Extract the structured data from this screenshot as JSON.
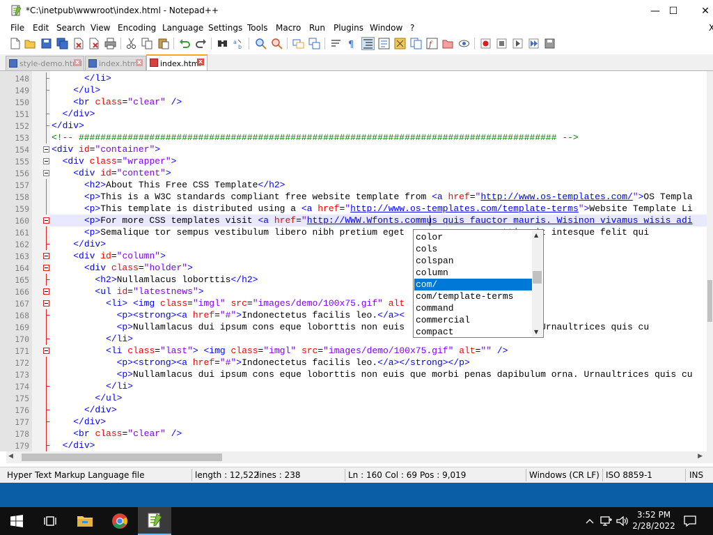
{
  "window": {
    "title": "*C:\\inetpub\\wwwroot\\index.html - Notepad++",
    "minimize": "—",
    "maximize": "☐",
    "close": "✕"
  },
  "menu": [
    "File",
    "Edit",
    "Search",
    "View",
    "Encoding",
    "Language",
    "Settings",
    "Tools",
    "Macro",
    "Run",
    "Plugins",
    "Window",
    "?"
  ],
  "menu_close": "X",
  "tabs": [
    {
      "label": "style-demo.html",
      "active": false
    },
    {
      "label": "index.html",
      "active": false
    },
    {
      "label": "index.html",
      "active": true
    }
  ],
  "tab_close": "x",
  "autocomplete": {
    "items": [
      "color",
      "cols",
      "colspan",
      "column",
      "com/",
      "com/template-terms",
      "command",
      "commercial",
      "compact"
    ],
    "selected": "com/"
  },
  "status": {
    "file_type": "Hyper Text Markup Language file",
    "length": "length : 12,522",
    "lines": "lines : 238",
    "ln": "Ln : 160",
    "col": "Col : 69",
    "pos": "Pos : 9,019",
    "eol": "Windows (CR LF)",
    "encoding": "ISO 8859-1",
    "mode": "INS"
  },
  "taskbar": {
    "time": "3:52 PM",
    "date": "2/28/2022"
  },
  "colors": {
    "tag": "#0000ff",
    "attr": "#ff0000",
    "value": "#8000ff",
    "comment": "#008000",
    "current_line": "#e8e8ff",
    "selection": "#0078d7",
    "desktop": "#0a5ea6"
  },
  "editor": {
    "current_line": "160",
    "lines": [
      {
        "n": "148",
        "ind": "      ",
        "tokens": [
          [
            "t",
            "</li>"
          ]
        ]
      },
      {
        "n": "149",
        "ind": "    ",
        "tokens": [
          [
            "t",
            "</ul>"
          ]
        ]
      },
      {
        "n": "150",
        "ind": "    ",
        "tokens": [
          [
            "t",
            "<br "
          ],
          [
            "a",
            "class"
          ],
          [
            "x",
            "="
          ],
          [
            "v",
            "\"clear\""
          ],
          [
            "t",
            " />"
          ]
        ]
      },
      {
        "n": "151",
        "ind": "  ",
        "tokens": [
          [
            "t",
            "</div>"
          ]
        ]
      },
      {
        "n": "152",
        "ind": "",
        "tokens": [
          [
            "t",
            "</div>"
          ]
        ]
      },
      {
        "n": "153",
        "ind": "",
        "tokens": [
          [
            "c",
            "<!-- ######################################################################################## -->"
          ]
        ]
      },
      {
        "n": "154",
        "ind": "",
        "tokens": [
          [
            "t",
            "<div "
          ],
          [
            "a",
            "id"
          ],
          [
            "x",
            "="
          ],
          [
            "v",
            "\"container\""
          ],
          [
            "t",
            ">"
          ]
        ]
      },
      {
        "n": "155",
        "ind": "  ",
        "tokens": [
          [
            "t",
            "<div "
          ],
          [
            "a",
            "class"
          ],
          [
            "x",
            "="
          ],
          [
            "v",
            "\"wrapper\""
          ],
          [
            "t",
            ">"
          ]
        ]
      },
      {
        "n": "156",
        "ind": "    ",
        "tokens": [
          [
            "t",
            "<div "
          ],
          [
            "a",
            "id"
          ],
          [
            "x",
            "="
          ],
          [
            "v",
            "\"content\""
          ],
          [
            "t",
            ">"
          ]
        ]
      },
      {
        "n": "157",
        "ind": "      ",
        "tokens": [
          [
            "t",
            "<h2>"
          ],
          [
            "x",
            "About This Free CSS Template"
          ],
          [
            "t",
            "</h2>"
          ]
        ]
      },
      {
        "n": "158",
        "ind": "      ",
        "tokens": [
          [
            "t",
            "<p>"
          ],
          [
            "x",
            "This is a W3C standards compliant free website template from "
          ],
          [
            "t",
            "<a "
          ],
          [
            "a",
            "href"
          ],
          [
            "x",
            "="
          ],
          [
            "v",
            "\""
          ],
          [
            "u",
            "http://www.os-templates.com/"
          ],
          [
            "v",
            "\""
          ],
          [
            "t",
            ">"
          ],
          [
            "x",
            "OS Templa"
          ]
        ]
      },
      {
        "n": "159",
        "ind": "      ",
        "tokens": [
          [
            "t",
            "<p>"
          ],
          [
            "x",
            "This template is distributed using a "
          ],
          [
            "t",
            "<a "
          ],
          [
            "a",
            "href"
          ],
          [
            "x",
            "="
          ],
          [
            "v",
            "\""
          ],
          [
            "u",
            "http://www.os-templates.com/template-terms"
          ],
          [
            "v",
            "\""
          ],
          [
            "t",
            ">"
          ],
          [
            "x",
            "Website Template Li"
          ]
        ]
      },
      {
        "n": "160",
        "ind": "      ",
        "tokens": [
          [
            "t",
            "<p>"
          ],
          [
            "x",
            "For more CSS templates visit "
          ],
          [
            "t",
            "<a "
          ],
          [
            "a",
            "href"
          ],
          [
            "x",
            "="
          ],
          [
            "v",
            "\""
          ],
          [
            "u",
            "http://WWW.Wfonts.commus quis fauctor mauris. Wisinon vivamus wisis adi"
          ]
        ]
      },
      {
        "n": "161",
        "ind": "      ",
        "tokens": [
          [
            "t",
            "<p>"
          ],
          [
            "x",
            "Semalique tor sempus vestibulum libero nibh pretium eget                orttis sit intesque felit qui"
          ]
        ]
      },
      {
        "n": "162",
        "ind": "    ",
        "tokens": [
          [
            "t",
            "</div>"
          ]
        ]
      },
      {
        "n": "163",
        "ind": "    ",
        "tokens": [
          [
            "t",
            "<div "
          ],
          [
            "a",
            "id"
          ],
          [
            "x",
            "="
          ],
          [
            "v",
            "\"column\""
          ],
          [
            "t",
            ">"
          ]
        ]
      },
      {
        "n": "164",
        "ind": "      ",
        "tokens": [
          [
            "t",
            "<div "
          ],
          [
            "a",
            "class"
          ],
          [
            "x",
            "="
          ],
          [
            "v",
            "\"holder\""
          ],
          [
            "t",
            ">"
          ]
        ]
      },
      {
        "n": "165",
        "ind": "        ",
        "tokens": [
          [
            "t",
            "<h2>"
          ],
          [
            "x",
            "Nullamlacus loborttis"
          ],
          [
            "t",
            "</h2>"
          ]
        ]
      },
      {
        "n": "166",
        "ind": "        ",
        "tokens": [
          [
            "t",
            "<ul "
          ],
          [
            "a",
            "id"
          ],
          [
            "x",
            "="
          ],
          [
            "v",
            "\"latestnews\""
          ],
          [
            "t",
            ">"
          ]
        ]
      },
      {
        "n": "167",
        "ind": "          ",
        "tokens": [
          [
            "t",
            "<li> <img "
          ],
          [
            "a",
            "class"
          ],
          [
            "x",
            "="
          ],
          [
            "v",
            "\"imgl\""
          ],
          [
            "t",
            " "
          ],
          [
            "a",
            "src"
          ],
          [
            "x",
            "="
          ],
          [
            "v",
            "\"images/demo/100x75.gif\""
          ],
          [
            "t",
            " "
          ],
          [
            "a",
            "alt"
          ]
        ]
      },
      {
        "n": "168",
        "ind": "            ",
        "tokens": [
          [
            "t",
            "<p><strong><a "
          ],
          [
            "a",
            "href"
          ],
          [
            "x",
            "="
          ],
          [
            "v",
            "\"#\""
          ],
          [
            "t",
            ">"
          ],
          [
            "x",
            "Indonectetus facilis leo."
          ],
          [
            "t",
            "</a><"
          ]
        ]
      },
      {
        "n": "169",
        "ind": "            ",
        "tokens": [
          [
            "t",
            "<p>"
          ],
          [
            "x",
            "Nullamlacus dui ipsum cons eque loborttis non euis                um orna. Urnaultrices quis cu"
          ]
        ]
      },
      {
        "n": "170",
        "ind": "          ",
        "tokens": [
          [
            "t",
            "</li>"
          ]
        ]
      },
      {
        "n": "171",
        "ind": "          ",
        "tokens": [
          [
            "t",
            "<li "
          ],
          [
            "a",
            "class"
          ],
          [
            "x",
            "="
          ],
          [
            "v",
            "\"last\""
          ],
          [
            "t",
            "> <img "
          ],
          [
            "a",
            "class"
          ],
          [
            "x",
            "="
          ],
          [
            "v",
            "\"imgl\""
          ],
          [
            "t",
            " "
          ],
          [
            "a",
            "src"
          ],
          [
            "x",
            "="
          ],
          [
            "v",
            "\"images/demo/100x75.gif\""
          ],
          [
            "t",
            " "
          ],
          [
            "a",
            "alt"
          ],
          [
            "x",
            "="
          ],
          [
            "v",
            "\"\""
          ],
          [
            "t",
            " />"
          ]
        ]
      },
      {
        "n": "172",
        "ind": "            ",
        "tokens": [
          [
            "t",
            "<p><strong><a "
          ],
          [
            "a",
            "href"
          ],
          [
            "x",
            "="
          ],
          [
            "v",
            "\"#\""
          ],
          [
            "t",
            ">"
          ],
          [
            "x",
            "Indonectetus facilis leo."
          ],
          [
            "t",
            "</a></strong></p>"
          ]
        ]
      },
      {
        "n": "173",
        "ind": "            ",
        "tokens": [
          [
            "t",
            "<p>"
          ],
          [
            "x",
            "Nullamlacus dui ipsum cons eque loborttis non euis que morbi penas dapibulum orna. Urnaultrices quis cu"
          ]
        ]
      },
      {
        "n": "174",
        "ind": "          ",
        "tokens": [
          [
            "t",
            "</li>"
          ]
        ]
      },
      {
        "n": "175",
        "ind": "        ",
        "tokens": [
          [
            "t",
            "</ul>"
          ]
        ]
      },
      {
        "n": "176",
        "ind": "      ",
        "tokens": [
          [
            "t",
            "</div>"
          ]
        ]
      },
      {
        "n": "177",
        "ind": "    ",
        "tokens": [
          [
            "t",
            "</div>"
          ]
        ]
      },
      {
        "n": "178",
        "ind": "    ",
        "tokens": [
          [
            "t",
            "<br "
          ],
          [
            "a",
            "class"
          ],
          [
            "x",
            "="
          ],
          [
            "v",
            "\"clear\""
          ],
          [
            "t",
            " />"
          ]
        ]
      },
      {
        "n": "179",
        "ind": "  ",
        "tokens": [
          [
            "t",
            "</div>"
          ]
        ]
      }
    ]
  }
}
